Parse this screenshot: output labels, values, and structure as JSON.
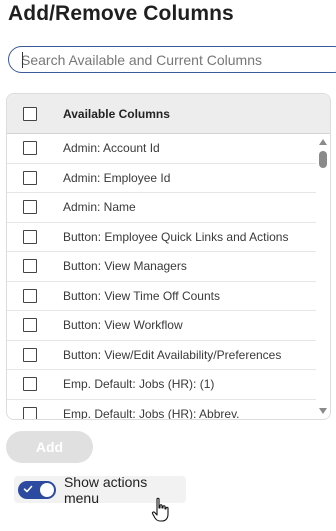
{
  "dialog": {
    "title": "Add/Remove Columns"
  },
  "search": {
    "placeholder": "Search Available and Current Columns",
    "value": ""
  },
  "table": {
    "header": "Available Columns",
    "rows": [
      {
        "label": "Admin: Account Id",
        "checked": false
      },
      {
        "label": "Admin: Employee Id",
        "checked": false
      },
      {
        "label": "Admin: Name",
        "checked": false
      },
      {
        "label": "Button: Employee Quick Links and Actions",
        "checked": false
      },
      {
        "label": "Button: View Managers",
        "checked": false
      },
      {
        "label": "Button: View Time Off Counts",
        "checked": false
      },
      {
        "label": "Button: View Workflow",
        "checked": false
      },
      {
        "label": "Button: View/Edit Availability/Preferences",
        "checked": false
      },
      {
        "label": "Emp. Default: Jobs (HR): (1)",
        "checked": false
      },
      {
        "label": "Emp. Default: Jobs (HR): Abbrev.",
        "checked": false
      }
    ]
  },
  "actions": {
    "add_label": "Add"
  },
  "toggle": {
    "label": "Show actions menu",
    "on": true
  },
  "colors": {
    "accent": "#2b4aa0",
    "focus_border": "#3b5a9a",
    "disabled_button": "#e0e0e0"
  },
  "icons": {
    "cursor": "hand-pointer-icon",
    "toggle_check": "check-icon"
  }
}
